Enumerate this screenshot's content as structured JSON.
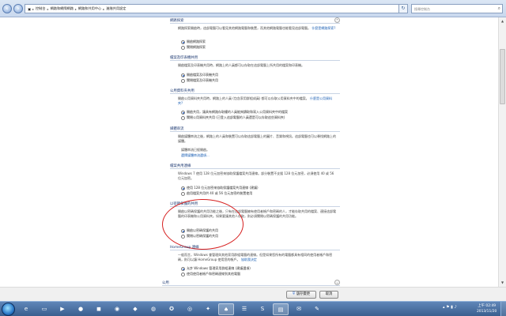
{
  "address": {
    "back_icon": "back-arrow-icon",
    "forward_icon": "forward-arrow-icon",
    "crumbs": [
      "控制台",
      "網路和網際網路",
      "網路和共用中心",
      "進階共用設定"
    ],
    "refresh_icon": "refresh-icon",
    "search_placeholder": "搜尋控制台"
  },
  "sections": {
    "s1": {
      "title": "網路探索",
      "desc": "網路探索開啟時，這部電腦可以看見其他網路電腦和裝置，而其他網路電腦也能看見這部電腦。",
      "desc_link": "什麼是網路探索?",
      "opt_on": "開啟網路探索",
      "opt_off": "關閉網路探索"
    },
    "s2": {
      "title": "檔案及印表機共用",
      "desc": "開啟檔案及印表機共用時，網路上的人員都可以存取在這部電腦上所共用的檔案和印表機。",
      "opt_on": "開啟檔案及印表機共用",
      "opt_off": "關閉檔案及印表機共用"
    },
    "s3": {
      "title": "公用資料夾共用",
      "desc": "開啟公用資料夾共用時，網路上的人員 (包含家用群組成員) 都可以存取公用資料夾中的檔案。",
      "desc_link": "什麼是公用資料夾?",
      "opt_on": "開啟共用，讓具有網路存取權的人員能夠讀取和寫入公用資料夾中的檔案",
      "opt_off": "關閉公用資料夾共用 (已登入這部電腦的人員還是可以存取這些資料夾)"
    },
    "s4": {
      "title": "媒體串流",
      "desc": "開啟媒體串流之後，網路上的人員和裝置可以存取這部電腦上的圖片、音樂和視訊。這部電腦也可以尋找網路上的媒體。",
      "status": "媒體串流已經開啟。",
      "link": "選擇媒體串流選項..."
    },
    "s5": {
      "title": "檔案共用連線",
      "desc": "Windows 7 使用 128 位元加密來協助保護檔案共用連線。部分裝置不支援 128 位元加密，必須使用 40 或 56 位元加密。",
      "opt_on": "使用 128 位元加密來協助保護檔案共用連線 (建議)",
      "opt_off": "啟用檔案共用供 40 或 56 位元加密的裝置使用"
    },
    "s6": {
      "title": "以密碼保護的共用",
      "desc": "開啟以密碼保護的共用功能之後，只有在這部電腦擁有使用者帳戶和密碼的人，才能存取共用的檔案、連接這部電腦的印表機和公用資料夾。如果要讓其他人存取，則必須關閉以密碼保護的共用功能。",
      "opt_on": "開啟以密碼保護的共用",
      "opt_off": "關閉以密碼保護的共用"
    },
    "s7": {
      "title": "HomeGroup 連線",
      "desc": "一般而言，Windows 會管理與其他家用群組電腦的連線。但是如果您所有的電腦都具有相同的使用者帳戶和密碼，則可以讓 HomeGroup 使用您的帳戶。",
      "desc_link": "協助我決定",
      "opt_on": "允許 Windows 管理家用群組連線 (建議選項)",
      "opt_off": "使用使用者帳戶和密碼連線到其他電腦"
    },
    "s8": {
      "title": "公用"
    }
  },
  "buttons": {
    "save": "儲存變更",
    "cancel": "取消"
  },
  "taskbar": {
    "time": "上午 02:49",
    "date": "2013/11/20"
  }
}
